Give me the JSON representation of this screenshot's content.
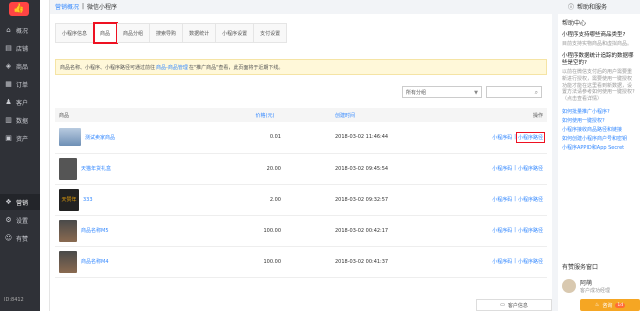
{
  "nav": {
    "items": [
      {
        "label": "概况",
        "icon": "home-icon",
        "glyph": "⌂"
      },
      {
        "label": "店铺",
        "icon": "store-icon",
        "glyph": "▤"
      },
      {
        "label": "商品",
        "icon": "goods-icon",
        "glyph": "◈"
      },
      {
        "label": "订单",
        "icon": "order-icon",
        "glyph": "▦"
      },
      {
        "label": "客户",
        "icon": "customer-icon",
        "glyph": "♟"
      },
      {
        "label": "数据",
        "icon": "data-icon",
        "glyph": "▥"
      },
      {
        "label": "资产",
        "icon": "asset-icon",
        "glyph": "▣"
      },
      {
        "label": "营销",
        "icon": "marketing-icon",
        "glyph": "❖"
      },
      {
        "label": "设置",
        "icon": "settings-icon",
        "glyph": "⚙"
      },
      {
        "label": "有赞",
        "icon": "youzan-icon",
        "glyph": "☺"
      }
    ],
    "footer": "ID:8412"
  },
  "breadcrumb": {
    "parent": "营销概况",
    "separator": "|",
    "current": "微信小程序"
  },
  "tabs": [
    "小程序信息",
    "商品",
    "商品分组",
    "搜索导购",
    "数据统计",
    "小程序设置",
    "支付设置"
  ],
  "notice": {
    "text1": "商品名称、小程序、小程序路径可通过前往",
    "link": "商品-商品管理",
    "text2": "在\"推广商品\"查看，此页面将于近期下线。"
  },
  "filter": {
    "group_select": "所有分组"
  },
  "table": {
    "headers": {
      "goods": "商品",
      "price": "价格(元)",
      "time": "创建时间",
      "ops": "操作"
    },
    "rows": [
      {
        "name": "测试卖家商品",
        "price": "0.01",
        "time": "2018-03-02 11:46:44",
        "op1": "小程序码",
        "op2": "小程序路径"
      },
      {
        "name": "天猫年货礼盒",
        "price": "20.00",
        "time": "2018-03-02 09:45:54",
        "op1": "小程序码",
        "op2": "小程序路径"
      },
      {
        "name": "333",
        "price": "2.00",
        "time": "2018-03-02 09:32:57",
        "op1": "小程序码",
        "op2": "小程序路径"
      },
      {
        "name": "商品名称M5",
        "price": "100.00",
        "time": "2018-03-02 00:42:17",
        "op1": "小程序码",
        "op2": "小程序路径"
      },
      {
        "name": "商品名称M4",
        "price": "100.00",
        "time": "2018-03-02 00:41:37",
        "op1": "小程序码",
        "op2": "小程序路径"
      }
    ],
    "thumb3_text": "天赞年"
  },
  "help": {
    "title": "帮助和服务",
    "center": "帮助中心",
    "q1": "小程序支持哪些商品类型?",
    "a1": "目前支持实物商品和虚拟商品。",
    "q2": "小程序数据统计追踪的数据哪些是空的?",
    "a2": "以前在微信支付后的用户需要重新进行授权，需要使用一键授权功能才能在这里看到新数据，设置方法请参考如何使用一键授权?（点击查看详情）",
    "links": [
      "如何批量推广小程序?",
      "如何使用一键授权?",
      "小程序接收商品路径和链接",
      "如何创建小程序商户号和密钥",
      "小程序APPID和App Secret"
    ],
    "service_title": "有赞服务窗口",
    "agent_name": "阿萌",
    "agent_role": "客户成功经理"
  },
  "buttons": {
    "service": "客户信息",
    "consult": "咨询",
    "consult_badge": "1d"
  }
}
